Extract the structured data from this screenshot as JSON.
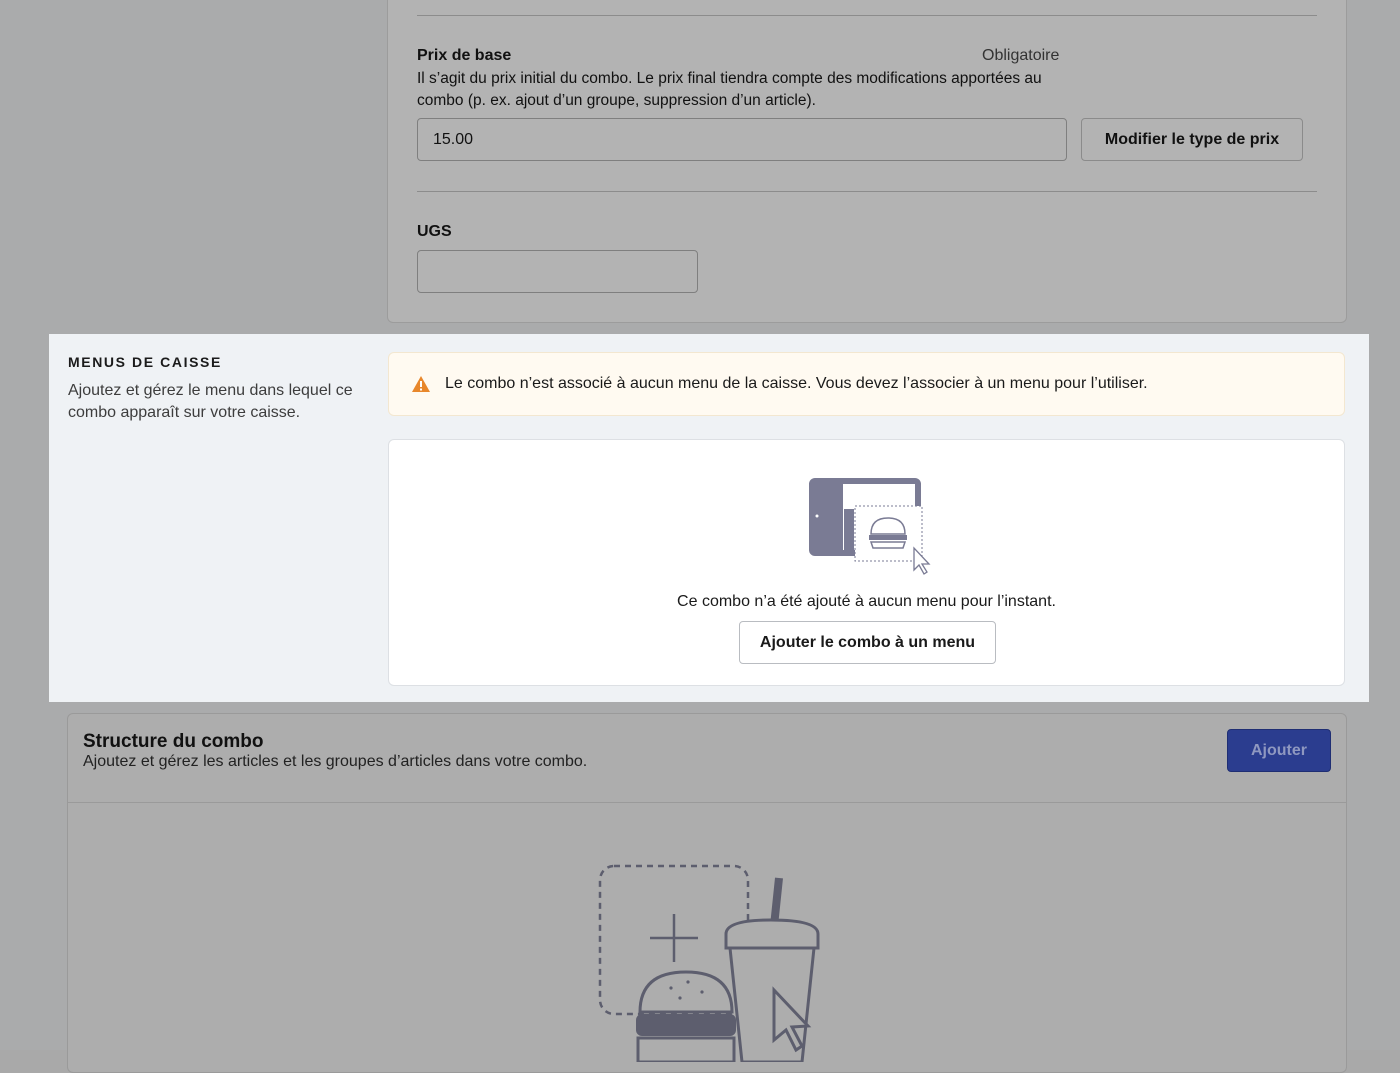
{
  "base_price": {
    "title": "Prix de base",
    "required_label": "Obligatoire",
    "description": "Il s’agit du prix initial du combo. Le prix final tiendra compte des modifications apportées au combo (p. ex. ajout d’un groupe, suppression d’un article).",
    "value": "15.00",
    "change_type_button": "Modifier le type de prix"
  },
  "sku": {
    "title": "UGS",
    "value": ""
  },
  "pos_menus": {
    "title": "MENUS DE CAISSE",
    "description": "Ajoutez et gérez le menu dans lequel ce combo apparaît sur votre caisse.",
    "alert_icon": "warning-icon",
    "alert_text": "Le combo n’est associé à aucun menu de la caisse. Vous devez l’associer à un menu pour l’utiliser.",
    "empty_illustration": "tablet-burger-illustration",
    "empty_text": "Ce combo n’a été ajouté à aucun menu pour l’instant.",
    "add_button": "Ajouter le combo à un menu"
  },
  "combo_structure": {
    "title": "Structure du combo",
    "description": "Ajoutez et gérez les articles et les groupes d’articles dans votre combo.",
    "add_button": "Ajouter",
    "illustration": "burger-drink-illustration"
  },
  "colors": {
    "primary_button": "#2b3d8f",
    "alert_icon": "#e8872b",
    "illustration": "#7a7b94"
  }
}
